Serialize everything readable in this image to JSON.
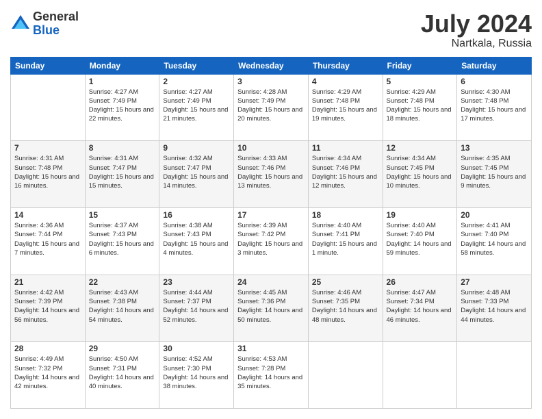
{
  "logo": {
    "general": "General",
    "blue": "Blue"
  },
  "title": {
    "month_year": "July 2024",
    "location": "Nartkala, Russia"
  },
  "calendar": {
    "headers": [
      "Sunday",
      "Monday",
      "Tuesday",
      "Wednesday",
      "Thursday",
      "Friday",
      "Saturday"
    ],
    "weeks": [
      [
        {
          "day": "",
          "sunrise": "",
          "sunset": "",
          "daylight": ""
        },
        {
          "day": "1",
          "sunrise": "Sunrise: 4:27 AM",
          "sunset": "Sunset: 7:49 PM",
          "daylight": "Daylight: 15 hours and 22 minutes."
        },
        {
          "day": "2",
          "sunrise": "Sunrise: 4:27 AM",
          "sunset": "Sunset: 7:49 PM",
          "daylight": "Daylight: 15 hours and 21 minutes."
        },
        {
          "day": "3",
          "sunrise": "Sunrise: 4:28 AM",
          "sunset": "Sunset: 7:49 PM",
          "daylight": "Daylight: 15 hours and 20 minutes."
        },
        {
          "day": "4",
          "sunrise": "Sunrise: 4:29 AM",
          "sunset": "Sunset: 7:48 PM",
          "daylight": "Daylight: 15 hours and 19 minutes."
        },
        {
          "day": "5",
          "sunrise": "Sunrise: 4:29 AM",
          "sunset": "Sunset: 7:48 PM",
          "daylight": "Daylight: 15 hours and 18 minutes."
        },
        {
          "day": "6",
          "sunrise": "Sunrise: 4:30 AM",
          "sunset": "Sunset: 7:48 PM",
          "daylight": "Daylight: 15 hours and 17 minutes."
        }
      ],
      [
        {
          "day": "7",
          "sunrise": "Sunrise: 4:31 AM",
          "sunset": "Sunset: 7:48 PM",
          "daylight": "Daylight: 15 hours and 16 minutes."
        },
        {
          "day": "8",
          "sunrise": "Sunrise: 4:31 AM",
          "sunset": "Sunset: 7:47 PM",
          "daylight": "Daylight: 15 hours and 15 minutes."
        },
        {
          "day": "9",
          "sunrise": "Sunrise: 4:32 AM",
          "sunset": "Sunset: 7:47 PM",
          "daylight": "Daylight: 15 hours and 14 minutes."
        },
        {
          "day": "10",
          "sunrise": "Sunrise: 4:33 AM",
          "sunset": "Sunset: 7:46 PM",
          "daylight": "Daylight: 15 hours and 13 minutes."
        },
        {
          "day": "11",
          "sunrise": "Sunrise: 4:34 AM",
          "sunset": "Sunset: 7:46 PM",
          "daylight": "Daylight: 15 hours and 12 minutes."
        },
        {
          "day": "12",
          "sunrise": "Sunrise: 4:34 AM",
          "sunset": "Sunset: 7:45 PM",
          "daylight": "Daylight: 15 hours and 10 minutes."
        },
        {
          "day": "13",
          "sunrise": "Sunrise: 4:35 AM",
          "sunset": "Sunset: 7:45 PM",
          "daylight": "Daylight: 15 hours and 9 minutes."
        }
      ],
      [
        {
          "day": "14",
          "sunrise": "Sunrise: 4:36 AM",
          "sunset": "Sunset: 7:44 PM",
          "daylight": "Daylight: 15 hours and 7 minutes."
        },
        {
          "day": "15",
          "sunrise": "Sunrise: 4:37 AM",
          "sunset": "Sunset: 7:43 PM",
          "daylight": "Daylight: 15 hours and 6 minutes."
        },
        {
          "day": "16",
          "sunrise": "Sunrise: 4:38 AM",
          "sunset": "Sunset: 7:43 PM",
          "daylight": "Daylight: 15 hours and 4 minutes."
        },
        {
          "day": "17",
          "sunrise": "Sunrise: 4:39 AM",
          "sunset": "Sunset: 7:42 PM",
          "daylight": "Daylight: 15 hours and 3 minutes."
        },
        {
          "day": "18",
          "sunrise": "Sunrise: 4:40 AM",
          "sunset": "Sunset: 7:41 PM",
          "daylight": "Daylight: 15 hours and 1 minute."
        },
        {
          "day": "19",
          "sunrise": "Sunrise: 4:40 AM",
          "sunset": "Sunset: 7:40 PM",
          "daylight": "Daylight: 14 hours and 59 minutes."
        },
        {
          "day": "20",
          "sunrise": "Sunrise: 4:41 AM",
          "sunset": "Sunset: 7:40 PM",
          "daylight": "Daylight: 14 hours and 58 minutes."
        }
      ],
      [
        {
          "day": "21",
          "sunrise": "Sunrise: 4:42 AM",
          "sunset": "Sunset: 7:39 PM",
          "daylight": "Daylight: 14 hours and 56 minutes."
        },
        {
          "day": "22",
          "sunrise": "Sunrise: 4:43 AM",
          "sunset": "Sunset: 7:38 PM",
          "daylight": "Daylight: 14 hours and 54 minutes."
        },
        {
          "day": "23",
          "sunrise": "Sunrise: 4:44 AM",
          "sunset": "Sunset: 7:37 PM",
          "daylight": "Daylight: 14 hours and 52 minutes."
        },
        {
          "day": "24",
          "sunrise": "Sunrise: 4:45 AM",
          "sunset": "Sunset: 7:36 PM",
          "daylight": "Daylight: 14 hours and 50 minutes."
        },
        {
          "day": "25",
          "sunrise": "Sunrise: 4:46 AM",
          "sunset": "Sunset: 7:35 PM",
          "daylight": "Daylight: 14 hours and 48 minutes."
        },
        {
          "day": "26",
          "sunrise": "Sunrise: 4:47 AM",
          "sunset": "Sunset: 7:34 PM",
          "daylight": "Daylight: 14 hours and 46 minutes."
        },
        {
          "day": "27",
          "sunrise": "Sunrise: 4:48 AM",
          "sunset": "Sunset: 7:33 PM",
          "daylight": "Daylight: 14 hours and 44 minutes."
        }
      ],
      [
        {
          "day": "28",
          "sunrise": "Sunrise: 4:49 AM",
          "sunset": "Sunset: 7:32 PM",
          "daylight": "Daylight: 14 hours and 42 minutes."
        },
        {
          "day": "29",
          "sunrise": "Sunrise: 4:50 AM",
          "sunset": "Sunset: 7:31 PM",
          "daylight": "Daylight: 14 hours and 40 minutes."
        },
        {
          "day": "30",
          "sunrise": "Sunrise: 4:52 AM",
          "sunset": "Sunset: 7:30 PM",
          "daylight": "Daylight: 14 hours and 38 minutes."
        },
        {
          "day": "31",
          "sunrise": "Sunrise: 4:53 AM",
          "sunset": "Sunset: 7:28 PM",
          "daylight": "Daylight: 14 hours and 35 minutes."
        },
        {
          "day": "",
          "sunrise": "",
          "sunset": "",
          "daylight": ""
        },
        {
          "day": "",
          "sunrise": "",
          "sunset": "",
          "daylight": ""
        },
        {
          "day": "",
          "sunrise": "",
          "sunset": "",
          "daylight": ""
        }
      ]
    ]
  }
}
